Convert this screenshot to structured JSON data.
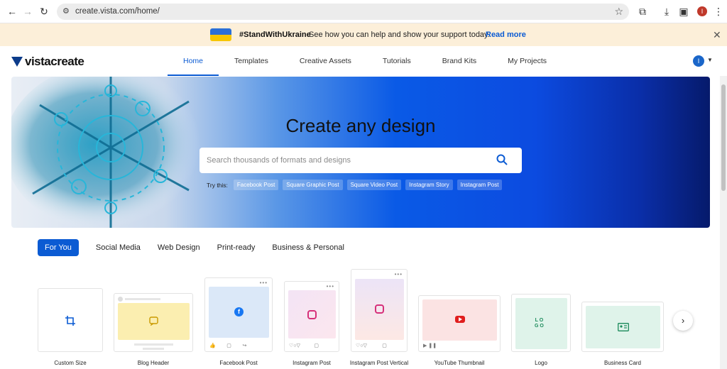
{
  "browser": {
    "url": "create.vista.com/home/"
  },
  "banner": {
    "tag": "#StandWithUkraine",
    "message": "See how you can help and show your support today.",
    "link": "Read more"
  },
  "nav": {
    "logo": "vistacreate",
    "items": [
      "Home",
      "Templates",
      "Creative Assets",
      "Tutorials",
      "Brand Kits",
      "My Projects"
    ],
    "active": "Home",
    "user_initial": "I"
  },
  "hero": {
    "title": "Create any design",
    "search_placeholder": "Search thousands of formats and designs",
    "try_label": "Try this:",
    "chips": [
      "Facebook Post",
      "Square Graphic Post",
      "Square Video Post",
      "Instagram Story",
      "Instagram Post"
    ]
  },
  "categories": [
    "For You",
    "Social Media",
    "Web Design",
    "Print-ready",
    "Business & Personal"
  ],
  "formats": [
    {
      "label": "Custom Size",
      "icon": "crop-icon"
    },
    {
      "label": "Blog Header",
      "icon": "chat-icon"
    },
    {
      "label": "Facebook Post",
      "icon": "facebook-icon"
    },
    {
      "label": "Instagram Post",
      "icon": "instagram-icon"
    },
    {
      "label": "Instagram Post Vertical",
      "icon": "instagram-icon"
    },
    {
      "label": "YouTube Thumbnail",
      "icon": "youtube-icon"
    },
    {
      "label": "Logo",
      "icon": "logo-icon"
    },
    {
      "label": "Business Card",
      "icon": "id-card-icon"
    }
  ],
  "colors": {
    "accent": "#0b5bd3",
    "banner_bg": "#fcefd9"
  }
}
